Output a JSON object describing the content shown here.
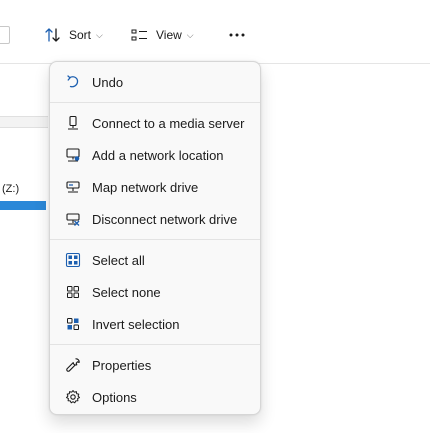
{
  "toolbar": {
    "sort_label": "Sort",
    "view_label": "View",
    "more_label": "See more"
  },
  "nav": {
    "drive_label": "(Z:)",
    "drive_usage_percent": 100
  },
  "menu": {
    "groups": [
      [
        {
          "label": "Undo",
          "icon": "undo-icon"
        }
      ],
      [
        {
          "label": "Connect to a media server",
          "icon": "media-server-icon"
        },
        {
          "label": "Add a network location",
          "icon": "network-location-icon"
        },
        {
          "label": "Map network drive",
          "icon": "map-network-drive-icon"
        },
        {
          "label": "Disconnect network drive",
          "icon": "disconnect-network-drive-icon"
        }
      ],
      [
        {
          "label": "Select all",
          "icon": "select-all-icon"
        },
        {
          "label": "Select none",
          "icon": "select-none-icon"
        },
        {
          "label": "Invert selection",
          "icon": "invert-selection-icon"
        }
      ],
      [
        {
          "label": "Properties",
          "icon": "properties-icon"
        },
        {
          "label": "Options",
          "icon": "gear-icon"
        }
      ]
    ]
  },
  "colors": {
    "accent": "#2b88d8",
    "selection_blue": "#1c5fb0",
    "menu_bg": "#f9f9f9"
  }
}
